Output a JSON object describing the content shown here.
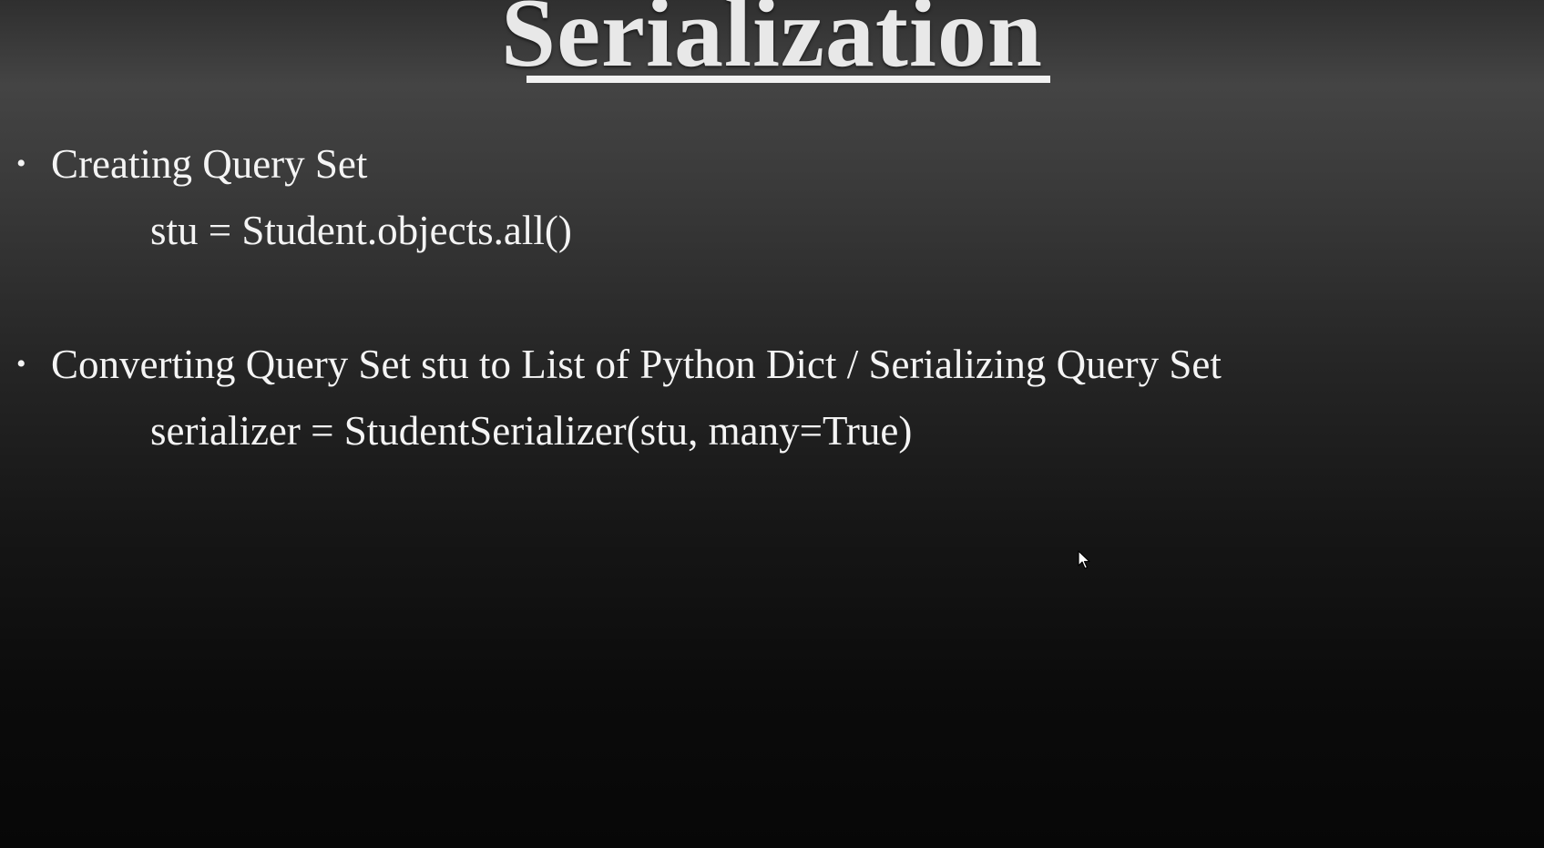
{
  "slide": {
    "title": "Serialization",
    "bullets": [
      {
        "text": "Creating Query Set",
        "code": "stu = Student.objects.all()"
      },
      {
        "text": "Converting Query Set stu to List of Python Dict / Serializing Query Set",
        "code": "serializer = StudentSerializer(stu, many=True)"
      }
    ],
    "bullet_glyph": "•"
  },
  "colors": {
    "text": "#f4f4f4",
    "title": "#e8e8e8"
  },
  "icons": {
    "cursor": "mouse-pointer-icon"
  }
}
